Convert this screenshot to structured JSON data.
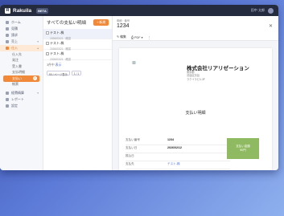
{
  "topbar": {
    "logo_mark": "R",
    "logo": "Rakuila",
    "badge": "BETA",
    "user": "田中 太郎"
  },
  "sidebar": {
    "items": [
      {
        "label": "ホーム"
      },
      {
        "label": "見積"
      },
      {
        "label": "請求"
      },
      {
        "label": "売上"
      },
      {
        "label": "仕入"
      }
    ],
    "sub_items": [
      {
        "label": "仕入先"
      },
      {
        "label": "発注"
      },
      {
        "label": "受入書"
      },
      {
        "label": "支払明細"
      },
      {
        "label": "支払い",
        "count": "3"
      },
      {
        "label": "帳票"
      }
    ],
    "bottom_items": [
      {
        "label": "経費精算"
      },
      {
        "label": "レポート"
      },
      {
        "label": "設定"
      }
    ]
  },
  "list": {
    "title": "すべての支払い明細",
    "new_label": "+ 新規",
    "items": [
      {
        "title": "テスト-株",
        "sub": "2026/03/21 · 確認"
      },
      {
        "title": "テスト-株",
        "sub": "2026/03/21 · 確認"
      },
      {
        "title": "テスト-株",
        "sub": "2026/03/21 · 確認"
      }
    ],
    "pager_text": "3件中",
    "pager_link": "表示",
    "per_page": "50 / ページ表示",
    "page": "1 / 1"
  },
  "detail": {
    "label": "明細 · 番号",
    "number": "1234",
    "tools": {
      "edit": "編集",
      "pdf": "PDF ▾",
      "more": "⋮"
    },
    "company_logo": "🏢",
    "company_name": "株式会社リアリゼーション",
    "company_info": [
      "東京都",
      "渋谷区渋谷",
      "ラクイラビル3F"
    ],
    "paper_title": "支払い明細",
    "fields": [
      {
        "label": "支払い番号",
        "value": "1234"
      },
      {
        "label": "支払い日",
        "value": "2026/02/12"
      },
      {
        "label": "振込日",
        "value": ""
      },
      {
        "label": "支払先",
        "value": "テスト-株"
      }
    ],
    "stamp_line1": "支払い金額",
    "stamp_line2": "¥0円"
  }
}
